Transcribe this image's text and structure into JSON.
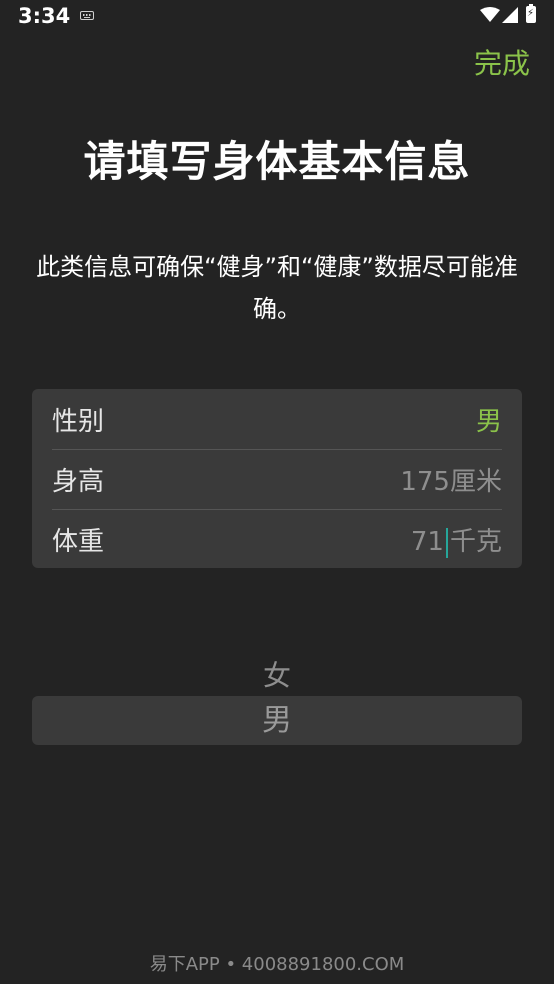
{
  "status_bar": {
    "time": "3:34",
    "icons": [
      "keyboard-icon",
      "wifi-icon",
      "signal-icon",
      "battery-charging-icon"
    ]
  },
  "header": {
    "done_label": "完成"
  },
  "title": "请填写身体基本信息",
  "description": "此类信息可确保“健身”和“健康”数据尽可能准确。",
  "info_rows": [
    {
      "label": "性别",
      "value": "男",
      "unit": ""
    },
    {
      "label": "身高",
      "value": "175",
      "unit": "厘米"
    },
    {
      "label": "体重",
      "value": "71",
      "unit": "千克"
    }
  ],
  "picker": {
    "options": [
      "女",
      "男"
    ],
    "selected": "男"
  },
  "watermark": "易下APP • 4008891800.COM",
  "colors": {
    "background": "#232323",
    "card": "#3a3a3a",
    "accent": "#8bc34a",
    "muted_text": "#8e8e8e",
    "cursor": "#26a69a"
  }
}
